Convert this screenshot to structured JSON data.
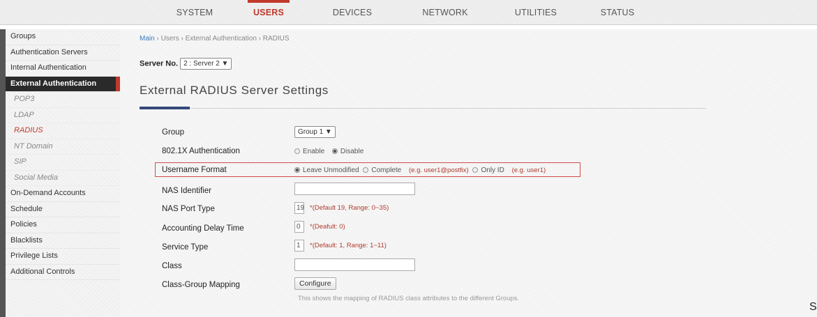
{
  "nav": {
    "tabs": [
      {
        "label": "SYSTEM"
      },
      {
        "label": "USERS"
      },
      {
        "label": "DEVICES"
      },
      {
        "label": "NETWORK"
      },
      {
        "label": "UTILITIES"
      },
      {
        "label": "STATUS"
      }
    ],
    "active_tab": "USERS",
    "accent_color": "#c0392b"
  },
  "sidebar": {
    "items": [
      {
        "label": "Groups"
      },
      {
        "label": "Authentication Servers"
      },
      {
        "label": "Internal Authentication"
      },
      {
        "label": "External Authentication"
      },
      {
        "label": "POP3"
      },
      {
        "label": "LDAP"
      },
      {
        "label": "RADIUS"
      },
      {
        "label": "NT Domain"
      },
      {
        "label": "SIP"
      },
      {
        "label": "Social Media"
      },
      {
        "label": "On-Demand Accounts"
      },
      {
        "label": "Schedule"
      },
      {
        "label": "Policies"
      },
      {
        "label": "Blacklists"
      },
      {
        "label": "Privilege Lists"
      },
      {
        "label": "Additional Controls"
      }
    ]
  },
  "breadcrumb": {
    "main": "Main",
    "sep": " › ",
    "users": "Users",
    "external": "External Authentication",
    "radius": "RADIUS"
  },
  "server": {
    "label": "Server No.",
    "value": "2 : Server 2 ▼"
  },
  "section_title": "External RADIUS Server Settings",
  "form": {
    "group": {
      "label": "Group",
      "value": "Group 1 ▼"
    },
    "dot1x": {
      "label": "802.1X Authentication",
      "enable": "Enable",
      "disable": "Disable"
    },
    "username_format": {
      "label": "Username Format",
      "opt1": "Leave Unmodified",
      "opt2": "Complete",
      "hint2": "(e.g. user1@postfix)",
      "opt3": "Only ID",
      "hint3": "(e.g. user1)"
    },
    "nas_identifier": {
      "label": "NAS Identifier",
      "value": ""
    },
    "nas_port_type": {
      "label": "NAS Port Type",
      "value": "19",
      "hint": "*(Default 19, Range: 0~35)"
    },
    "accounting_delay": {
      "label": "Accounting Delay Time",
      "value": "0",
      "hint": "*(Deafult: 0)"
    },
    "service_type": {
      "label": "Service Type",
      "value": "1",
      "hint": "*(Default: 1, Range: 1~11)"
    },
    "class": {
      "label": "Class",
      "value": ""
    },
    "class_group_mapping": {
      "label": "Class-Group Mapping",
      "button": "Configure",
      "note": "This shows the mapping of RADIUS class attributes to the different Groups."
    }
  },
  "stray_char": "S"
}
